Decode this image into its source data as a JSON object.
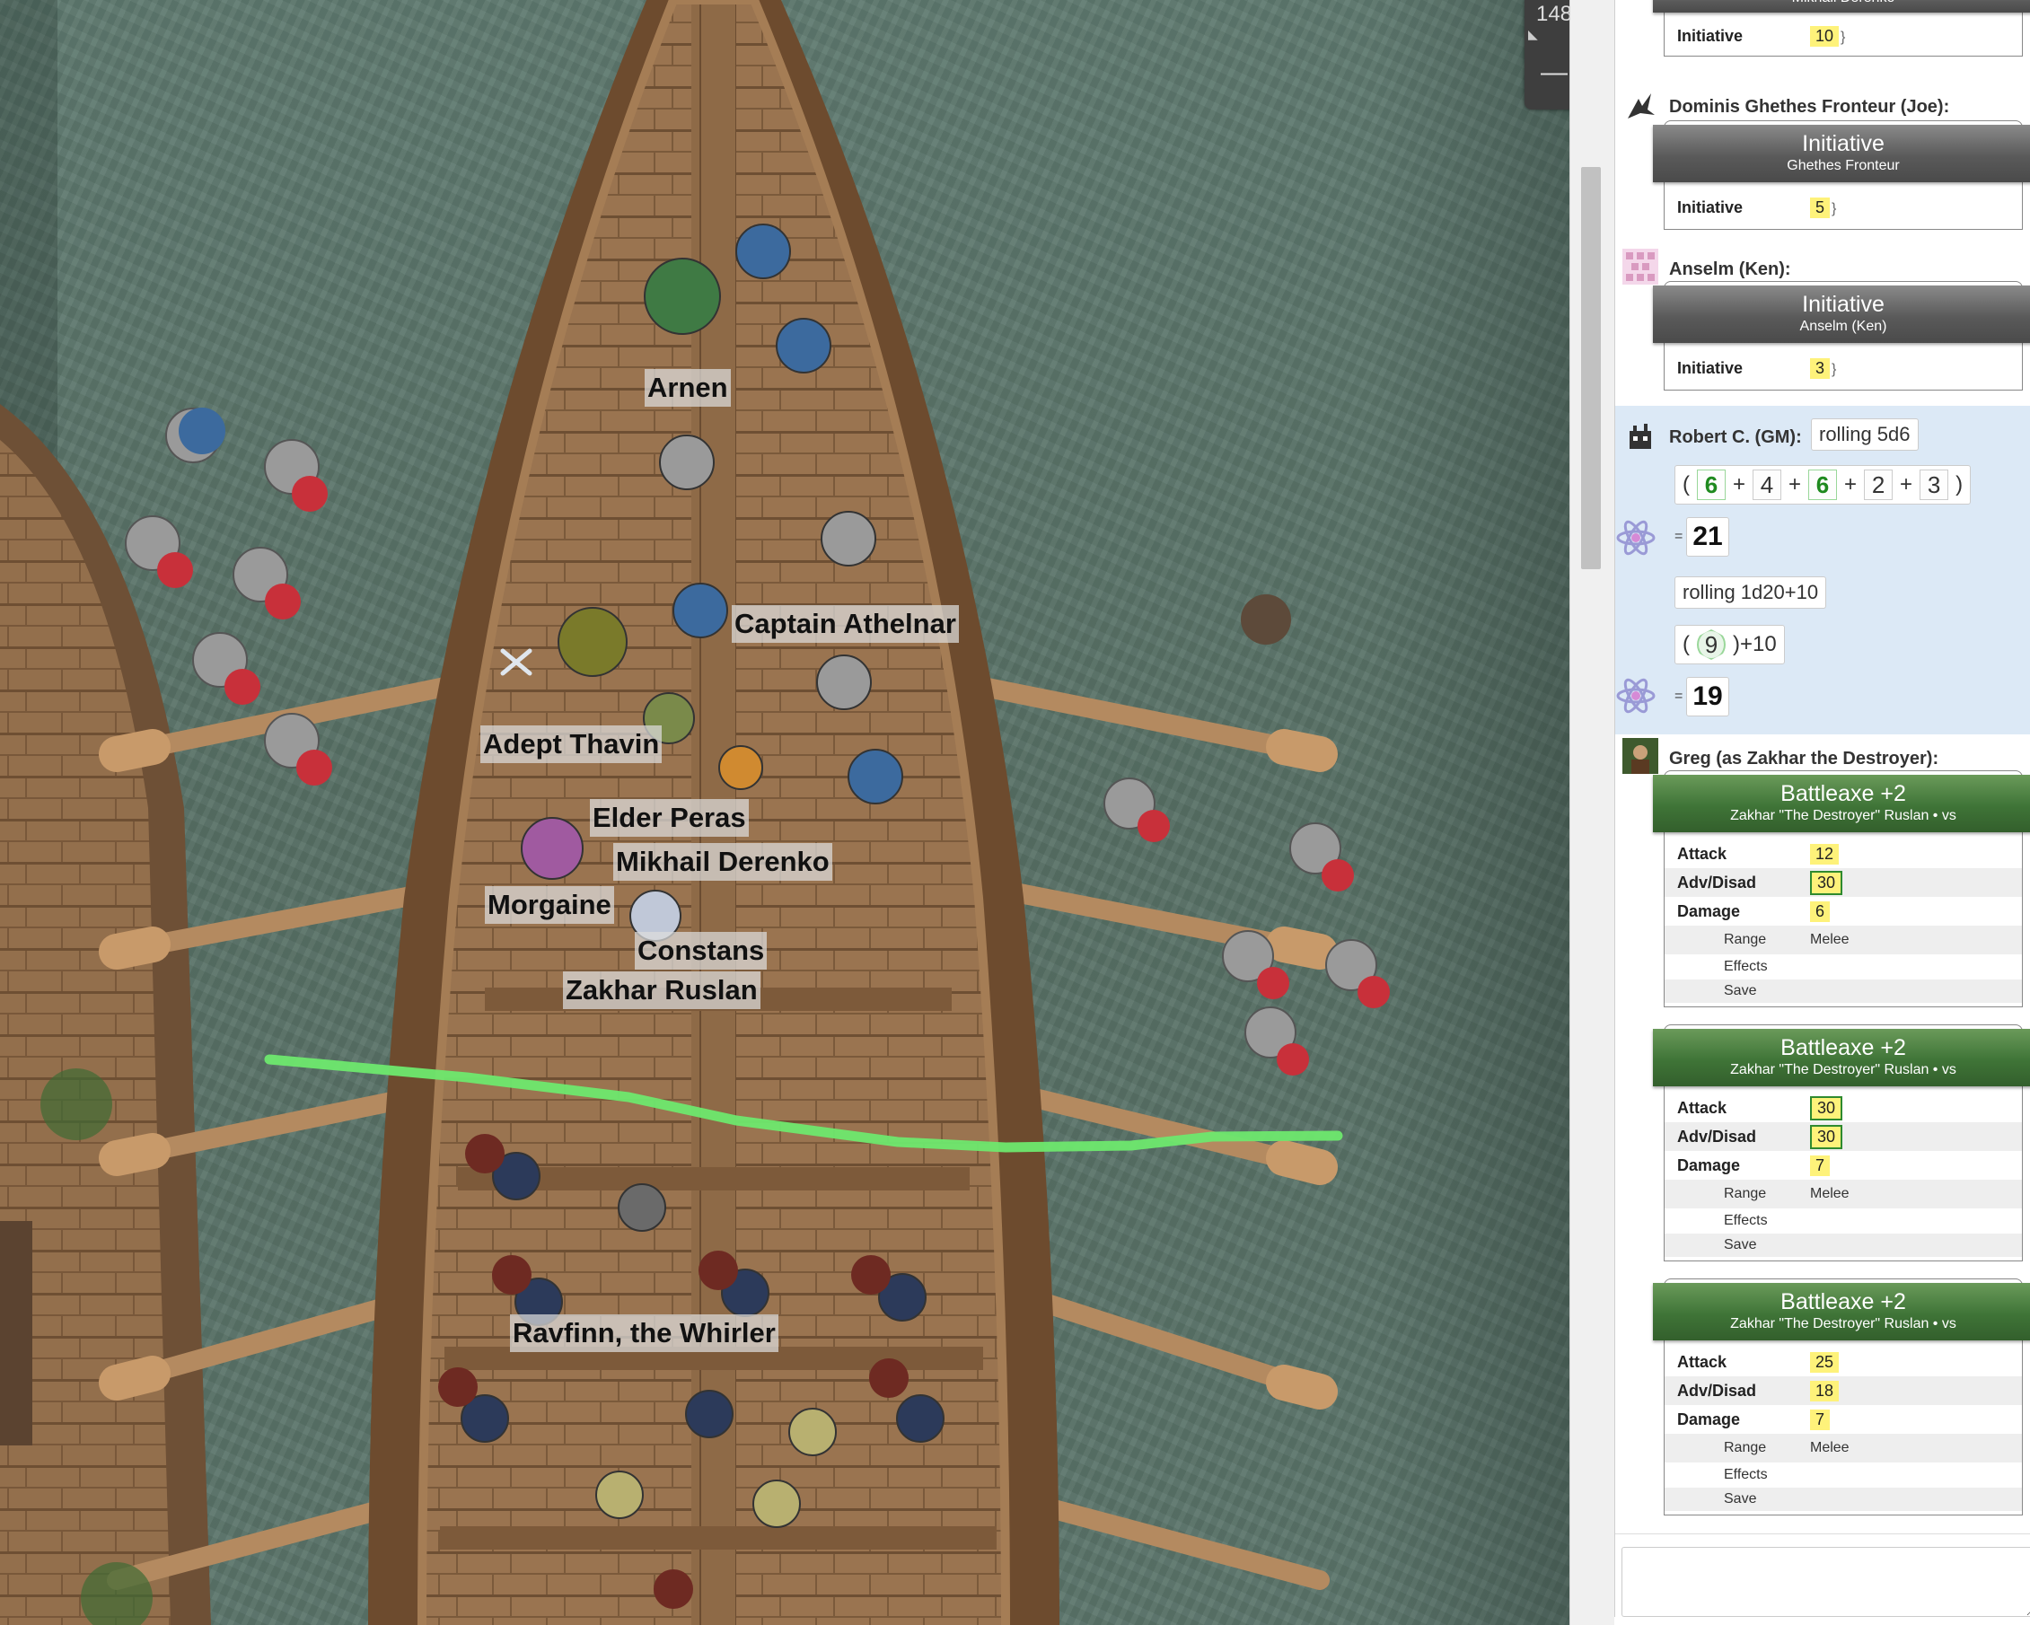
{
  "map": {
    "zoom_value": "148",
    "token_labels": [
      "Arnen",
      "Captain Athelnar",
      "Adept Thavin",
      "Elder Peras",
      "Mikhail Derenko",
      "Morgaine",
      "Constans",
      "Zakhar Ruslan",
      "Ravfinn, the Whirler"
    ]
  },
  "chat": {
    "msg0": {
      "head_subtitle": "Mikhail Derenko",
      "row": {
        "label": "Initiative",
        "value": "10"
      }
    },
    "msg1": {
      "byline": "Dominis Ghethes Fronteur (Joe):",
      "head_title": "Initiative",
      "head_subtitle": "Ghethes Fronteur",
      "row": {
        "label": "Initiative",
        "value": "5"
      }
    },
    "msg2": {
      "byline": "Anselm (Ken):",
      "head_title": "Initiative",
      "head_subtitle": "Anselm (Ken)",
      "row": {
        "label": "Initiative",
        "value": "3"
      }
    },
    "roll": {
      "byline": "Robert C. (GM):",
      "formula1": "rolling 5d6",
      "dice1": [
        "6",
        "4",
        "6",
        "2",
        "3"
      ],
      "total1": "21",
      "formula2": "rolling 1d20+10",
      "d20": "9",
      "mod2": "+10",
      "total2": "19",
      "open_paren": "(",
      "close_paren": ")",
      "plus": "+",
      "equals": "="
    },
    "greg": {
      "byline": "Greg (as Zakhar the Destroyer):",
      "cards": [
        {
          "title": "Battleaxe +2",
          "subtitle": "Zakhar \"The Destroyer\" Ruslan • vs",
          "attack": "12",
          "adv": "30",
          "damage": "6",
          "range": "Melee"
        },
        {
          "title": "Battleaxe +2",
          "subtitle": "Zakhar \"The Destroyer\" Ruslan • vs",
          "attack": "30",
          "adv": "30",
          "damage": "7",
          "range": "Melee"
        },
        {
          "title": "Battleaxe +2",
          "subtitle": "Zakhar \"The Destroyer\" Ruslan • vs",
          "attack": "25",
          "adv": "18",
          "damage": "7",
          "range": "Melee"
        }
      ],
      "labels": {
        "attack": "Attack",
        "adv": "Adv/Disad",
        "damage": "Damage",
        "range": "Range",
        "effects": "Effects",
        "save": "Save"
      }
    },
    "input_placeholder": ""
  },
  "colors": {
    "water": "#5b756b",
    "hull": "#7a5534",
    "deck": "#9c7652",
    "green_line": "#6ee86e",
    "card_green": "#3f7437",
    "card_gray": "#5a5a5a",
    "roll_bg": "#dce9f6",
    "highlight": "#fef27a"
  }
}
